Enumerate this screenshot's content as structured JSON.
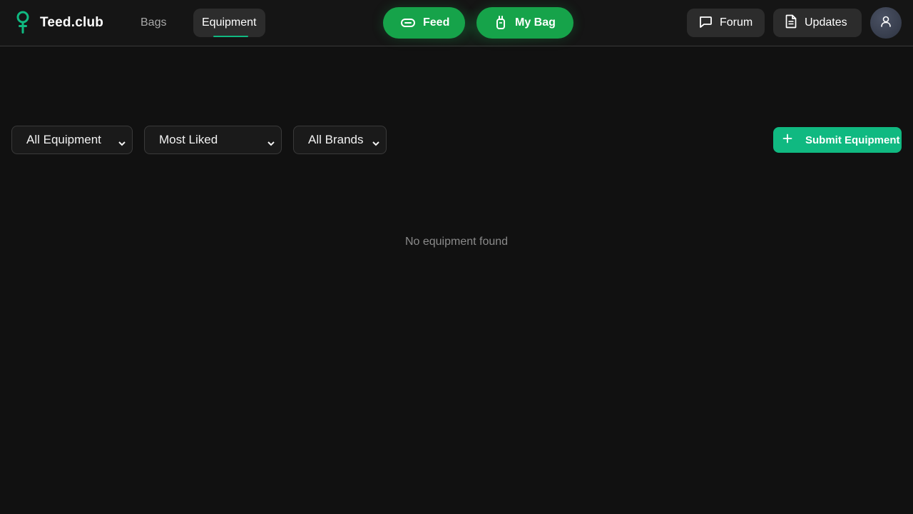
{
  "brand": {
    "name": "Teed.club"
  },
  "nav": {
    "bags_label": "Bags",
    "equipment_label": "Equipment"
  },
  "actions": {
    "feed_label": "Feed",
    "my_bag_label": "My Bag"
  },
  "tabs": {
    "forum_label": "Forum",
    "updates_label": "Updates"
  },
  "filters": {
    "category_selected": "All Equipment",
    "sort_selected": "Most Liked",
    "brand_selected": "All Brands"
  },
  "submit": {
    "label": "Submit Equipment"
  },
  "empty_state": {
    "message": "No equipment found"
  },
  "colors": {
    "accent_green": "#16a34a",
    "submit_green": "#10b981",
    "background": "#111111"
  },
  "icons": {
    "logo": "golf-tee-icon",
    "feed": "feed-icon",
    "my_bag": "golf-bag-icon",
    "forum": "message-square-icon",
    "updates": "file-text-icon",
    "avatar": "user-icon",
    "submit": "plus-icon",
    "select": "chevron-down-icon"
  }
}
